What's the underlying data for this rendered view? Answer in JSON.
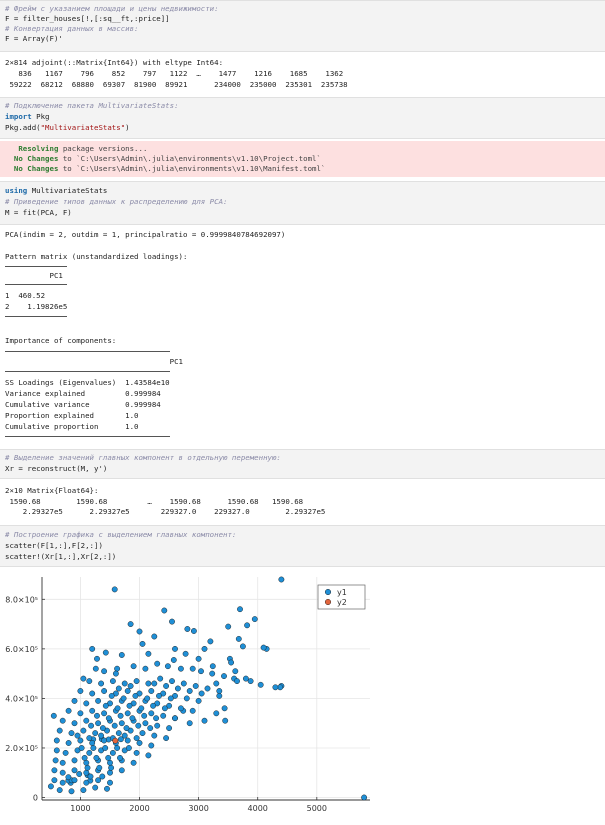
{
  "cell1": {
    "comment1": "# Фрейм с указанием площади и цены недвижимости:",
    "code1": "F = filter_houses[!,[:sq__ft,:price]]",
    "comment2": "# Конвертация данных в массив:",
    "code2": "F = Array(F)'"
  },
  "out1": {
    "header": "2×814 adjoint(::Matrix{Int64}) with eltype Int64:",
    "row1": "   836   1167    796    852    797   1122  …    1477    1216    1685    1362",
    "row2": " 59222  68212  68880  69307  81900  89921      234000  235000  235301  235738"
  },
  "cell2": {
    "comment": "# Подключение пакета MultivariateStats:",
    "import_kw": "import",
    "import_rest": " Pkg",
    "add_pre": "Pkg.add(",
    "add_str": "\"MultivariateStats\"",
    "add_post": ")"
  },
  "err": {
    "l1_kw": "   Resolving",
    "l1_rest": " package versions...",
    "l2_kw": "  No Changes",
    "l2_rest": " to `C:\\Users\\Admin\\.julia\\environments\\v1.10\\Project.toml`",
    "l3_kw": "  No Changes",
    "l3_rest": " to `C:\\Users\\Admin\\.julia\\environments\\v1.10\\Manifest.toml`"
  },
  "cell3": {
    "using_kw": "using",
    "using_rest": " MultivariateStats",
    "comment": "# Приведение типов данных к распределению для PCA:",
    "code": "M = fit(PCA, F)"
  },
  "out2": {
    "pca": "PCA(indim = 2, outdim = 1, principalratio = 0.9999840784692097)",
    "pattern_title": "Pattern matrix (unstandardized loadings):",
    "pattern_header": "          PC1",
    "pattern_row1": "1  460.52",
    "pattern_row2": "2    1.19826e5",
    "importance_title": "Importance of components:",
    "importance_header": "                                     PC1",
    "rows": [
      "SS Loadings (Eigenvalues)  1.43584e10",
      "Variance explained         0.999984",
      "Cumulative variance        0.999984",
      "Proportion explained       1.0",
      "Cumulative proportion      1.0"
    ]
  },
  "cell4": {
    "comment": "# Выделение значений главных компонент в отдельную переменную:",
    "code": "Xr = reconstruct(M, y')"
  },
  "out3": {
    "header": "2×10 Matrix{Float64}:",
    "row1": " 1590.68        1590.68         …    1590.68      1590.68   1590.68",
    "row2": "    2.29327e5      2.29327e5       229327.0    229327.0        2.29327e5"
  },
  "cell5": {
    "comment": "# Построение графика с выделением главных компонент:",
    "code1": "scatter(F[1,:],F[2,:])",
    "code2": "scatter!(Xr[1,:],Xr[2,:])"
  },
  "colors": {
    "y1": "#1f8fd6",
    "y2": "#e2653c"
  },
  "chart_data": {
    "type": "scatter",
    "xlim": [
      350,
      5900
    ],
    "ylim": [
      -10000,
      890000
    ],
    "xticks": [
      1000,
      2000,
      3000,
      4000,
      5000
    ],
    "xtick_labels": [
      "1000",
      "2000",
      "3000",
      "4000",
      "5000"
    ],
    "yticks": [
      0,
      200000,
      400000,
      600000,
      800000
    ],
    "ytick_labels": [
      "0",
      "2.0×10⁵",
      "4.0×10⁵",
      "6.0×10⁵",
      "8.0×10⁵"
    ],
    "grid": true,
    "legend": "top-right",
    "series": [
      {
        "name": "y1",
        "points": [
          [
            836,
            59222
          ],
          [
            1167,
            68212
          ],
          [
            796,
            68880
          ],
          [
            852,
            69307
          ],
          [
            797,
            81900
          ],
          [
            1122,
            89921
          ],
          [
            1477,
            234000
          ],
          [
            1216,
            235000
          ],
          [
            1685,
            235301
          ],
          [
            1362,
            235738
          ],
          [
            4400,
            880000
          ],
          [
            1580,
            840000
          ],
          [
            3700,
            760000
          ],
          [
            2420,
            755000
          ],
          [
            2550,
            710000
          ],
          [
            3820,
            695000
          ],
          [
            3500,
            690000
          ],
          [
            3950,
            720000
          ],
          [
            2810,
            680000
          ],
          [
            2920,
            672000
          ],
          [
            2000,
            670000
          ],
          [
            3680,
            640000
          ],
          [
            3750,
            610000
          ],
          [
            1850,
            700000
          ],
          [
            2250,
            650000
          ],
          [
            3200,
            630000
          ],
          [
            3100,
            600000
          ],
          [
            4150,
            600000
          ],
          [
            4100,
            605000
          ],
          [
            2050,
            620000
          ],
          [
            2600,
            600000
          ],
          [
            1700,
            575000
          ],
          [
            1200,
            600000
          ],
          [
            1430,
            585000
          ],
          [
            2780,
            580000
          ],
          [
            1620,
            520000
          ],
          [
            2150,
            580000
          ],
          [
            3530,
            560000
          ],
          [
            3550,
            545000
          ],
          [
            3620,
            510000
          ],
          [
            3240,
            530000
          ],
          [
            3000,
            560000
          ],
          [
            2580,
            555000
          ],
          [
            1280,
            560000
          ],
          [
            4400,
            450000
          ],
          [
            4380,
            445000
          ],
          [
            4050,
            455000
          ],
          [
            3880,
            470000
          ],
          [
            3600,
            480000
          ],
          [
            3430,
            490000
          ],
          [
            3230,
            500000
          ],
          [
            3040,
            510000
          ],
          [
            2900,
            520000
          ],
          [
            2700,
            520000
          ],
          [
            2480,
            530000
          ],
          [
            2300,
            540000
          ],
          [
            2100,
            520000
          ],
          [
            1900,
            530000
          ],
          [
            1600,
            500000
          ],
          [
            1400,
            510000
          ],
          [
            1260,
            520000
          ],
          [
            550,
            330000
          ],
          [
            5800,
            0
          ],
          [
            3440,
            360000
          ],
          [
            3450,
            310000
          ],
          [
            3100,
            310000
          ],
          [
            3300,
            340000
          ],
          [
            2850,
            300000
          ],
          [
            2600,
            320000
          ],
          [
            2740,
            350000
          ],
          [
            1050,
            480000
          ],
          [
            1150,
            470000
          ],
          [
            1350,
            460000
          ],
          [
            1550,
            470000
          ],
          [
            1750,
            460000
          ],
          [
            1950,
            470000
          ],
          [
            2150,
            460000
          ],
          [
            2350,
            480000
          ],
          [
            2550,
            470000
          ],
          [
            2750,
            460000
          ],
          [
            2950,
            450000
          ],
          [
            3150,
            440000
          ],
          [
            3350,
            430000
          ],
          [
            1000,
            430000
          ],
          [
            1200,
            420000
          ],
          [
            1400,
            430000
          ],
          [
            1600,
            420000
          ],
          [
            1800,
            430000
          ],
          [
            2000,
            420000
          ],
          [
            2200,
            430000
          ],
          [
            2400,
            420000
          ],
          [
            2600,
            410000
          ],
          [
            2800,
            400000
          ],
          [
            3000,
            390000
          ],
          [
            900,
            390000
          ],
          [
            1100,
            380000
          ],
          [
            1300,
            390000
          ],
          [
            1500,
            380000
          ],
          [
            1700,
            390000
          ],
          [
            1900,
            380000
          ],
          [
            2100,
            390000
          ],
          [
            2300,
            380000
          ],
          [
            2500,
            370000
          ],
          [
            2700,
            360000
          ],
          [
            2900,
            350000
          ],
          [
            800,
            350000
          ],
          [
            1000,
            340000
          ],
          [
            1200,
            350000
          ],
          [
            1400,
            340000
          ],
          [
            1600,
            350000
          ],
          [
            1800,
            340000
          ],
          [
            2000,
            350000
          ],
          [
            2200,
            340000
          ],
          [
            2400,
            330000
          ],
          [
            2600,
            320000
          ],
          [
            700,
            310000
          ],
          [
            900,
            300000
          ],
          [
            1100,
            310000
          ],
          [
            1300,
            300000
          ],
          [
            1500,
            310000
          ],
          [
            1700,
            300000
          ],
          [
            1900,
            310000
          ],
          [
            2100,
            300000
          ],
          [
            2300,
            290000
          ],
          [
            2500,
            280000
          ],
          [
            650,
            270000
          ],
          [
            850,
            260000
          ],
          [
            1050,
            270000
          ],
          [
            1250,
            260000
          ],
          [
            1450,
            270000
          ],
          [
            1650,
            260000
          ],
          [
            1850,
            270000
          ],
          [
            2050,
            260000
          ],
          [
            2250,
            250000
          ],
          [
            2450,
            240000
          ],
          [
            600,
            230000
          ],
          [
            800,
            220000
          ],
          [
            1000,
            230000
          ],
          [
            1200,
            220000
          ],
          [
            1400,
            230000
          ],
          [
            1600,
            220000
          ],
          [
            1800,
            230000
          ],
          [
            2000,
            220000
          ],
          [
            2200,
            210000
          ],
          [
            600,
            190000
          ],
          [
            750,
            180000
          ],
          [
            950,
            190000
          ],
          [
            1150,
            180000
          ],
          [
            1350,
            190000
          ],
          [
            1550,
            180000
          ],
          [
            1750,
            190000
          ],
          [
            1950,
            180000
          ],
          [
            2150,
            170000
          ],
          [
            580,
            150000
          ],
          [
            700,
            140000
          ],
          [
            900,
            150000
          ],
          [
            1100,
            140000
          ],
          [
            1300,
            150000
          ],
          [
            1500,
            140000
          ],
          [
            1700,
            150000
          ],
          [
            1900,
            140000
          ],
          [
            560,
            110000
          ],
          [
            700,
            100000
          ],
          [
            900,
            110000
          ],
          [
            1100,
            100000
          ],
          [
            1300,
            110000
          ],
          [
            1500,
            100000
          ],
          [
            1700,
            110000
          ],
          [
            560,
            70000
          ],
          [
            700,
            60000
          ],
          [
            900,
            70000
          ],
          [
            1100,
            60000
          ],
          [
            1300,
            70000
          ],
          [
            1500,
            60000
          ],
          [
            500,
            45000
          ],
          [
            650,
            30000
          ],
          [
            850,
            25000
          ],
          [
            1050,
            30000
          ],
          [
            1250,
            40000
          ],
          [
            1450,
            35000
          ],
          [
            950,
            250000
          ],
          [
            1150,
            240000
          ],
          [
            1350,
            250000
          ],
          [
            1550,
            240000
          ],
          [
            1750,
            250000
          ],
          [
            1950,
            240000
          ],
          [
            1020,
            200000
          ],
          [
            1220,
            200000
          ],
          [
            1420,
            200000
          ],
          [
            1620,
            200000
          ],
          [
            1820,
            200000
          ],
          [
            1070,
            160000
          ],
          [
            1270,
            160000
          ],
          [
            1470,
            160000
          ],
          [
            1670,
            160000
          ],
          [
            1120,
            120000
          ],
          [
            1320,
            120000
          ],
          [
            1520,
            120000
          ],
          [
            1170,
            85000
          ],
          [
            1370,
            85000
          ],
          [
            980,
            95000
          ],
          [
            1180,
            290000
          ],
          [
            1380,
            280000
          ],
          [
            1580,
            290000
          ],
          [
            1780,
            280000
          ],
          [
            1980,
            290000
          ],
          [
            2180,
            280000
          ],
          [
            1280,
            330000
          ],
          [
            1480,
            320000
          ],
          [
            1680,
            330000
          ],
          [
            1880,
            320000
          ],
          [
            2080,
            330000
          ],
          [
            2280,
            320000
          ],
          [
            1430,
            370000
          ],
          [
            1630,
            360000
          ],
          [
            1830,
            370000
          ],
          [
            2030,
            360000
          ],
          [
            2230,
            370000
          ],
          [
            2430,
            360000
          ],
          [
            1530,
            410000
          ],
          [
            1730,
            400000
          ],
          [
            1930,
            410000
          ],
          [
            2130,
            400000
          ],
          [
            2330,
            410000
          ],
          [
            2530,
            400000
          ],
          [
            4300,
            445000
          ],
          [
            3800,
            480000
          ],
          [
            3650,
            470000
          ],
          [
            3300,
            460000
          ],
          [
            3350,
            410000
          ],
          [
            2650,
            440000
          ],
          [
            2850,
            430000
          ],
          [
            3050,
            420000
          ],
          [
            2450,
            450000
          ],
          [
            2250,
            460000
          ],
          [
            1850,
            450000
          ],
          [
            1650,
            440000
          ]
        ]
      },
      {
        "name": "y2",
        "points": [
          [
            1590.68,
            229327
          ]
        ]
      }
    ]
  }
}
